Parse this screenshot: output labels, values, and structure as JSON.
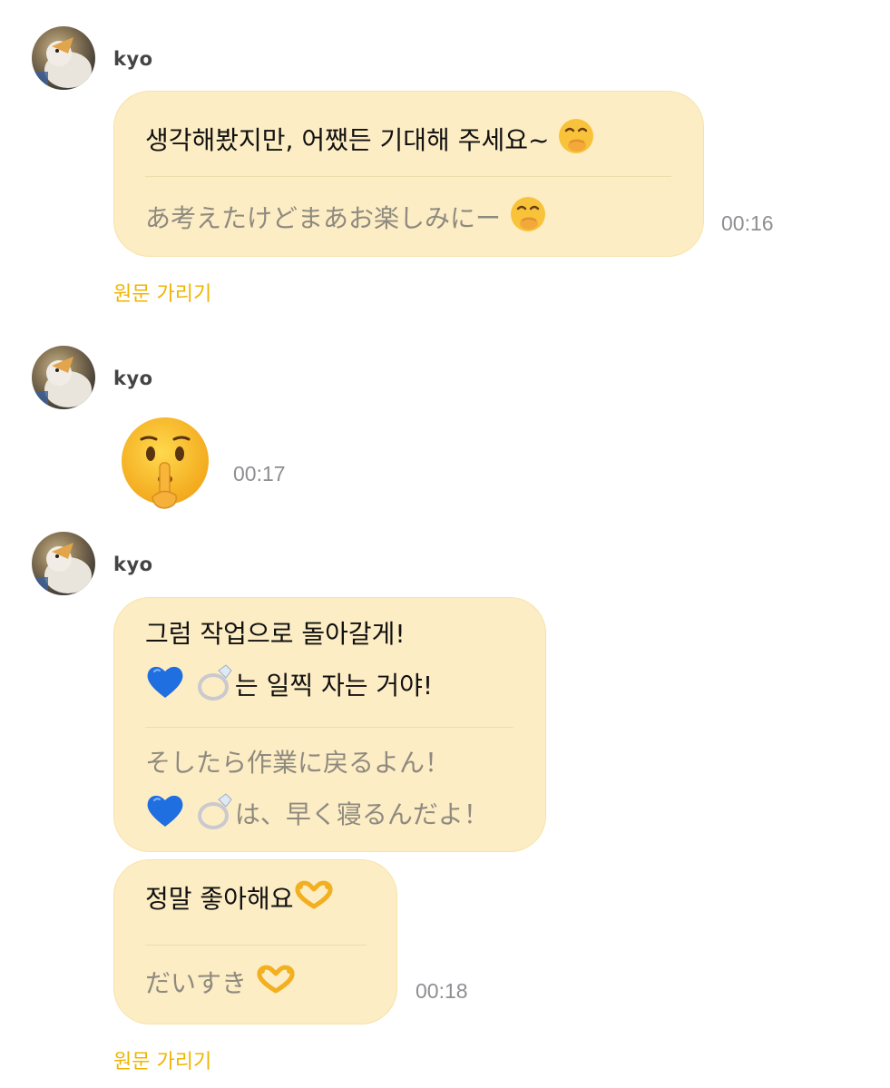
{
  "messages": [
    {
      "sender": "kyo",
      "original": "생각해봤지만, 어쨌든 기대해 주세요~",
      "translation": "あ考えたけどまあお楽しみにー",
      "time": "00:16",
      "toggle": "원문 가리기",
      "emoji": "hand-over-mouth-emoji"
    },
    {
      "sender": "kyo",
      "sticker": "shushing-face-emoji",
      "time": "00:17"
    },
    {
      "sender": "kyo",
      "original_line1": "그럼 작업으로 돌아갈게!",
      "original_line2": "는 일찍 자는 거야!",
      "translation_line1": "そしたら作業に戻るよん！",
      "translation_line2": "は、早く寝るんだよ！",
      "emojis": [
        "blue-heart-emoji",
        "ring-emoji"
      ]
    },
    {
      "original": "정말 좋아해요",
      "translation": "だいすき",
      "time": "00:18",
      "toggle": "원문 가리기",
      "emoji": "heart-hands-emoji"
    }
  ],
  "colors": {
    "bubble": "#fdedc4",
    "toggle": "#f0b400",
    "time": "#8e8e93",
    "translation": "#8f8a80"
  }
}
